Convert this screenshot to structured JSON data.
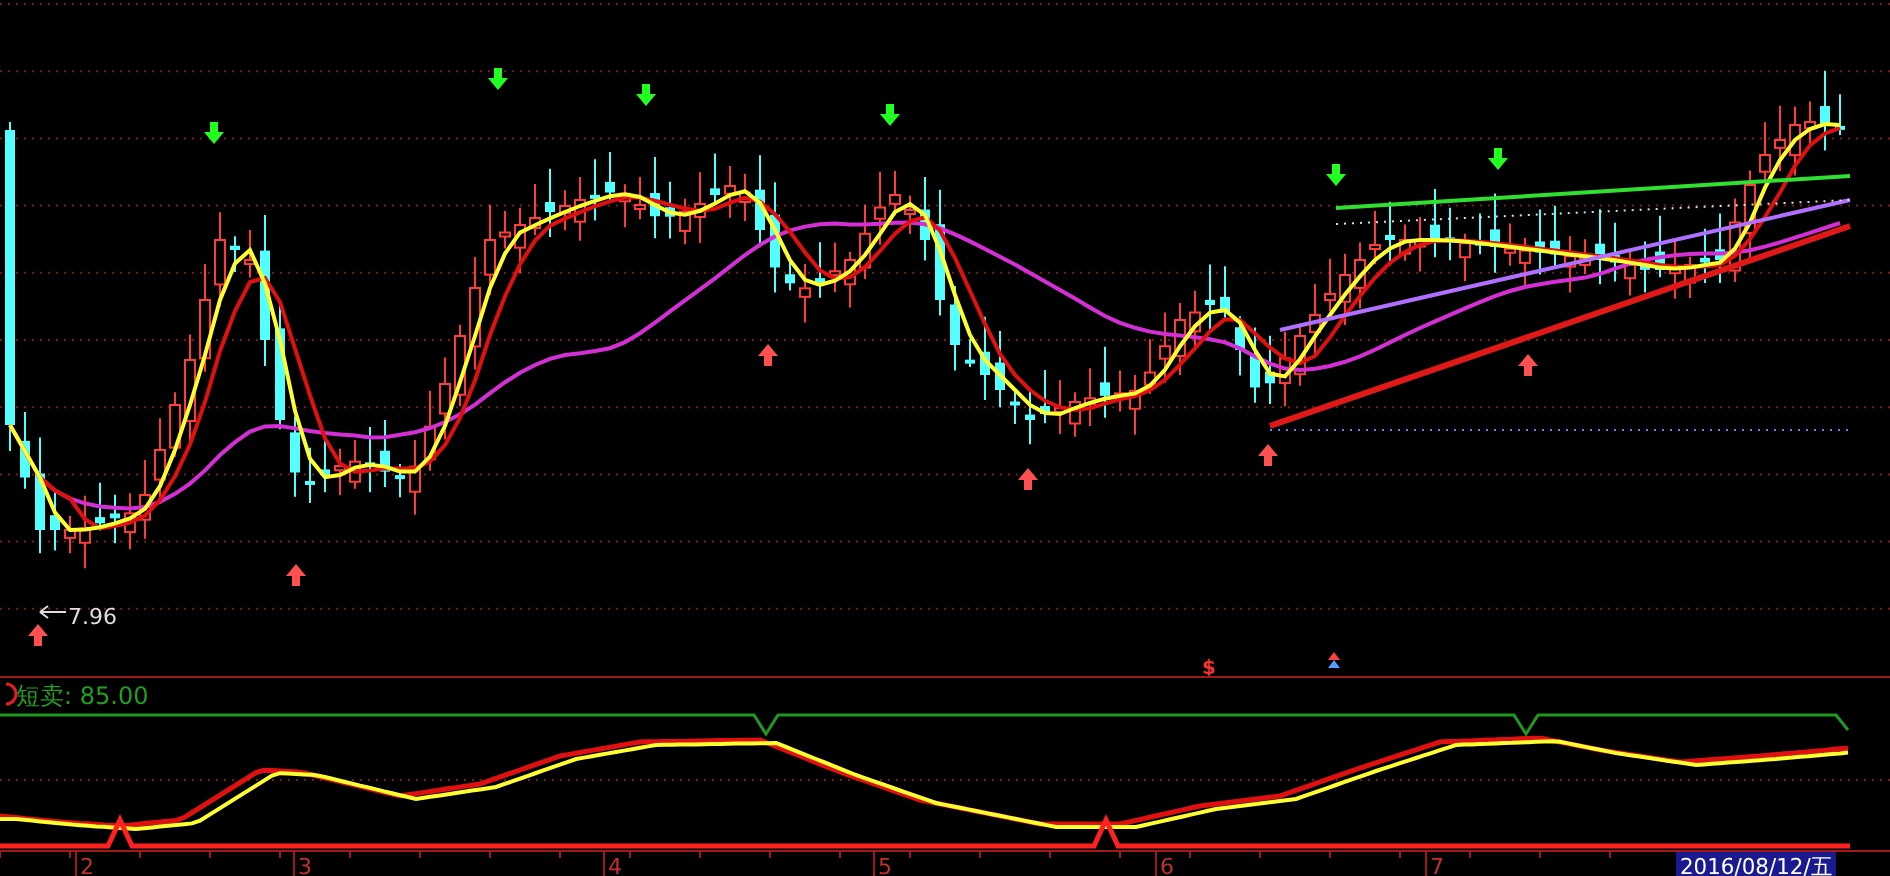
{
  "price_chart": {
    "low_price_label": "7.96",
    "signal_mark": "$"
  },
  "indicator_panel": {
    "label": "短卖: 85.00"
  },
  "x_axis": {
    "labels": [
      "2",
      "3",
      "4",
      "5",
      "6",
      "7"
    ],
    "cursor_date": "2016/08/12/五"
  }
}
